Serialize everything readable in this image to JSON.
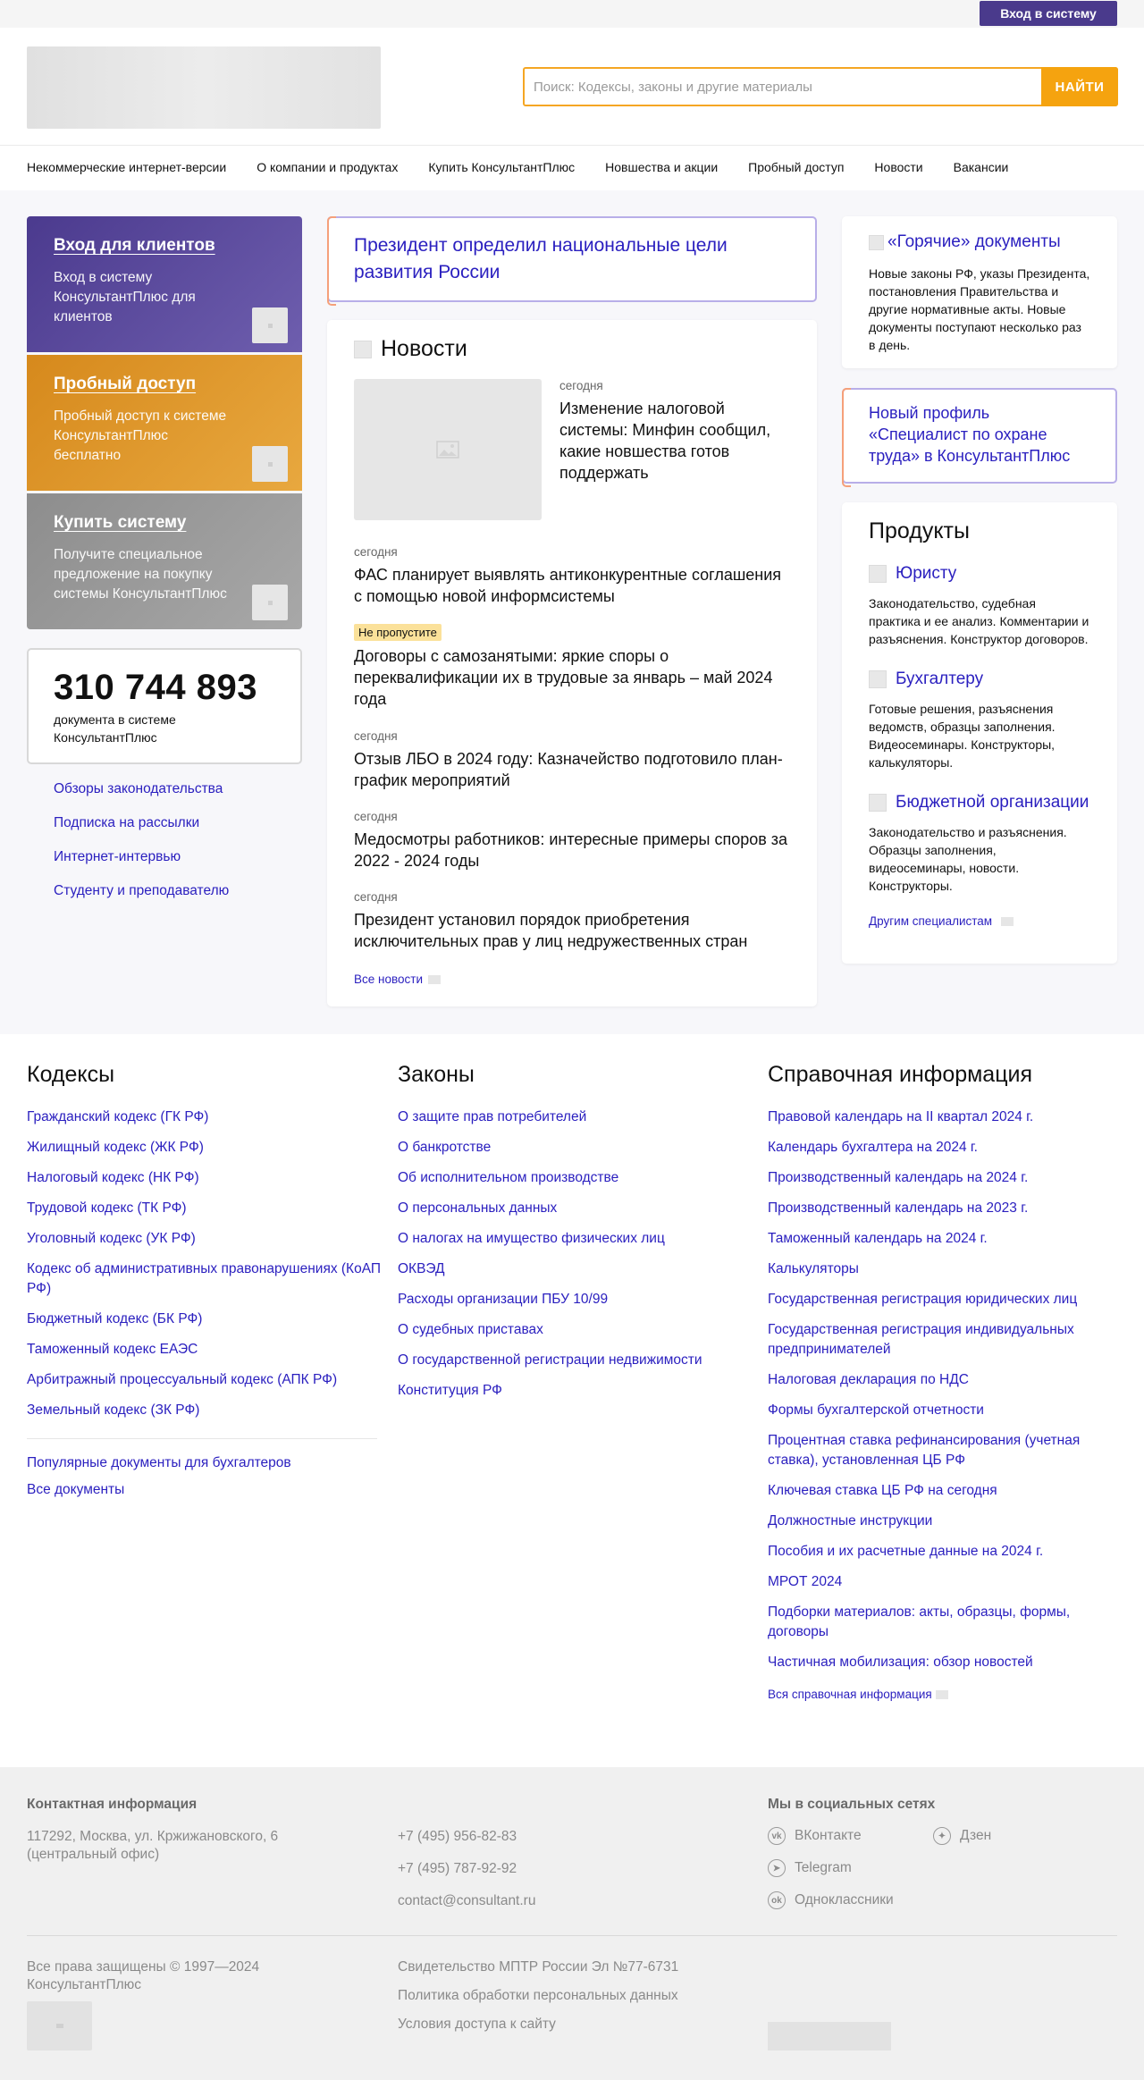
{
  "topbar": {
    "login_button": "Вход в систему"
  },
  "header": {
    "search_placeholder": "Поиск: Кодексы, законы и другие материалы",
    "search_button": "НАЙТИ"
  },
  "nav": [
    "Некоммерческие интернет-версии",
    "О компании и продуктах",
    "Купить КонсультантПлюс",
    "Новшества и акции",
    "Пробный доступ",
    "Новости",
    "Вакансии"
  ],
  "promos": [
    {
      "title": "Вход для клиентов",
      "desc": "Вход в систему КонсультантПлюс для клиентов"
    },
    {
      "title": "Пробный доступ",
      "desc": "Пробный доступ к системе КонсультантПлюс бесплатно"
    },
    {
      "title": "Купить систему",
      "desc": "Получите специальное предложение на покупку системы КонсультантПлюс"
    }
  ],
  "counter": {
    "number": "310 744 893",
    "caption": "документа в системе КонсультантПлюс"
  },
  "left_links": [
    "Обзоры законодательства",
    "Подписка на рассылки",
    "Интернет-интервью",
    "Студенту и преподавателю"
  ],
  "headline": "Президент определил национальные цели развития России",
  "news": {
    "title": "Новости",
    "items": [
      {
        "meta": "сегодня",
        "title": "Изменение налоговой системы: Минфин сообщил, какие новшества готов поддержать"
      },
      {
        "meta": "сегодня",
        "title": "ФАС планирует выявлять антиконкурентные соглашения с помощью новой информсистемы"
      },
      {
        "meta": "Не пропустите",
        "title": "Договоры с самозанятыми: яркие споры о переквалификации их в трудовые за январь – май 2024 года"
      },
      {
        "meta": "сегодня",
        "title": "Отзыв ЛБО в 2024 году: Казначейство подготовило план-график мероприятий"
      },
      {
        "meta": "сегодня",
        "title": "Медосмотры работников: интересные примеры споров за 2022 - 2024 годы"
      },
      {
        "meta": "сегодня",
        "title": "Президент установил порядок приобретения исключительных прав у лиц недружественных стран"
      }
    ],
    "all_link": "Все новости"
  },
  "hot": {
    "title": "«Горячие» документы",
    "desc": "Новые законы РФ, указы Президента, постановления Правительства и другие нормативные акты. Новые документы поступают несколько раз в день."
  },
  "new_profile": "Новый профиль «Специалист по охране труда» в КонсультантПлюс",
  "products": {
    "title": "Продукты",
    "items": [
      {
        "title": "Юристу",
        "desc": "Законодательство, судебная практика и ее анализ. Комментарии и разъяснения. Конструктор договоров."
      },
      {
        "title": "Бухгалтеру",
        "desc": "Готовые решения, разъяснения ведомств, образцы заполнения. Видеосеминары. Конструкторы, калькуляторы."
      },
      {
        "title": "Бюджетной организации",
        "desc": "Законодательство и разъяснения. Образцы заполнения, видеосеминары, новости. Конструкторы."
      }
    ],
    "other": "Другим специалистам"
  },
  "codes": {
    "title": "Кодексы",
    "items": [
      "Гражданский кодекс (ГК РФ)",
      "Жилищный кодекс (ЖК РФ)",
      "Налоговый кодекс (НК РФ)",
      "Трудовой кодекс (ТК РФ)",
      "Уголовный кодекс (УК РФ)",
      "Кодекс об административных правонарушениях (КоАП РФ)",
      "Бюджетный кодекс (БК РФ)",
      "Таможенный кодекс ЕАЭС",
      "Арбитражный процессуальный кодекс (АПК РФ)",
      "Земельный кодекс (ЗК РФ)"
    ],
    "extra": [
      "Популярные документы для бухгалтеров",
      "Все документы"
    ]
  },
  "laws": {
    "title": "Законы",
    "items": [
      "О защите прав потребителей",
      "О банкротстве",
      "Об исполнительном производстве",
      "О персональных данных",
      "О налогах на имущество физических лиц",
      "ОКВЭД",
      "Расходы организации ПБУ 10/99",
      "О судебных приставах",
      "О государственной регистрации недвижимости",
      "Конституция РФ"
    ]
  },
  "reference": {
    "title": "Справочная информация",
    "items": [
      "Правовой календарь на II квартал 2024 г.",
      "Календарь бухгалтера на 2024 г.",
      "Производственный календарь на 2024 г.",
      "Производственный календарь на 2023 г.",
      "Таможенный календарь на 2024 г.",
      "Калькуляторы",
      "Государственная регистрация юридических лиц",
      "Государственная регистрация индивидуальных предпринимателей",
      "Налоговая декларация по НДС",
      "Формы бухгалтерской отчетности",
      "Процентная ставка рефинансирования (учетная ставка), установленная ЦБ РФ",
      "Ключевая ставка ЦБ РФ на сегодня",
      "Должностные инструкции",
      "Пособия и их расчетные данные на 2024 г.",
      "МРОТ 2024",
      "Подборки материалов: акты, образцы, формы, договоры",
      "Частичная мобилизация: обзор новостей"
    ],
    "all_link": "Вся справочная информация"
  },
  "footer": {
    "contact_title": "Контактная информация",
    "address": "117292, Москва, ул. Кржижановского, 6 (центральный офис)",
    "phone1": "+7 (495) 956-82-83",
    "phone2": "+7 (495) 787-92-92",
    "email": "contact@consultant.ru",
    "social_title": "Мы в социальных сетях",
    "social": [
      {
        "name": "ВКонтакте",
        "icon": "vk-icon"
      },
      {
        "name": "Дзен",
        "icon": "dzen-icon"
      },
      {
        "name": "Telegram",
        "icon": "telegram-icon"
      },
      {
        "name": "Одноклассники",
        "icon": "ok-icon"
      }
    ],
    "copyright": "Все права защищены © 1997—2024 КонсультантПлюс",
    "certificate": "Свидетельство МПТР России Эл №77-6731",
    "privacy": "Политика обработки персональных данных",
    "terms": "Условия доступа к сайту"
  }
}
